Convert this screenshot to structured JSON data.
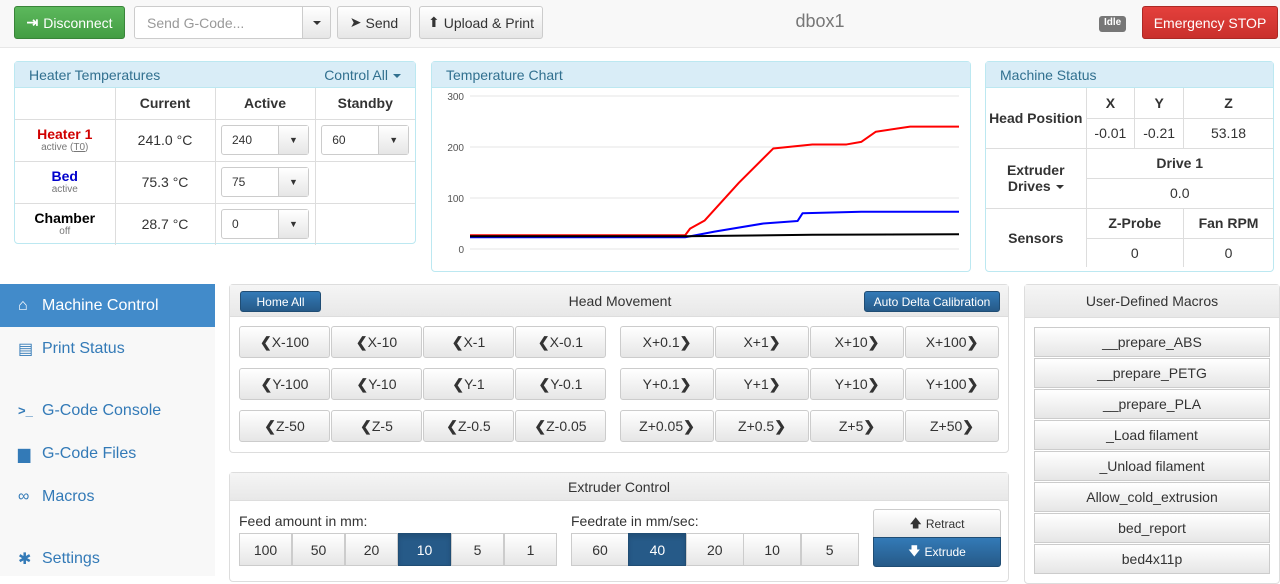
{
  "topbar": {
    "disconnect": "Disconnect",
    "gcode_placeholder": "Send G-Code...",
    "send": "Send",
    "upload_print": "Upload & Print",
    "machine_name": "dbox1",
    "status": "Idle",
    "emergency": "Emergency STOP"
  },
  "heaters": {
    "title": "Heater Temperatures",
    "control_all": "Control All",
    "headers": [
      "Current",
      "Active",
      "Standby"
    ],
    "rows": [
      {
        "name": "Heater 1",
        "state": "active",
        "tool": "T0",
        "current": "241.0 °C",
        "active": "240",
        "standby": "60",
        "color": "#d00000"
      },
      {
        "name": "Bed",
        "state": "active",
        "current": "75.3 °C",
        "active": "75",
        "color": "#0000cc"
      },
      {
        "name": "Chamber",
        "state": "off",
        "current": "28.7 °C",
        "active": "0",
        "color": "#000000"
      }
    ]
  },
  "chart": {
    "title": "Temperature Chart",
    "ylim": [
      0,
      300
    ],
    "yticks": [
      "300",
      "200",
      "100",
      "0"
    ]
  },
  "chart_data": {
    "type": "line",
    "ylim": [
      0,
      300
    ],
    "yticks": [
      0,
      100,
      200,
      300
    ],
    "grid": true,
    "series": [
      {
        "color": "#ff0000",
        "x": [
          0,
          30,
          40,
          44,
          45,
          48,
          55,
          62,
          70,
          77,
          80,
          83,
          90,
          100
        ],
        "values": [
          27,
          27,
          27,
          27,
          40,
          56,
          130,
          197,
          205,
          205,
          210,
          230,
          240,
          240
        ]
      },
      {
        "color": "#0000ff",
        "x": [
          0,
          30,
          44,
          50,
          60,
          67,
          68,
          80,
          100
        ],
        "values": [
          23,
          23,
          23,
          34,
          50,
          55,
          70,
          73,
          73
        ]
      },
      {
        "color": "#000000",
        "x": [
          0,
          30,
          44,
          70,
          100
        ],
        "values": [
          25,
          25,
          25,
          28,
          29
        ]
      }
    ]
  },
  "machine": {
    "title": "Machine Status",
    "head_position": "Head Position",
    "axes": [
      "X",
      "Y",
      "Z"
    ],
    "positions": [
      "-0.01",
      "-0.21",
      "53.18"
    ],
    "extruder_drives": "Extruder Drives",
    "drive_label": "Drive 1",
    "drive_value": "0.0",
    "sensors": "Sensors",
    "zprobe_label": "Z-Probe",
    "zprobe_value": "0",
    "fan_label": "Fan RPM",
    "fan_value": "0"
  },
  "sidebar": {
    "items": [
      {
        "label": "Machine Control",
        "icon": "home-icon",
        "glyph": "⌂"
      },
      {
        "label": "Print Status",
        "icon": "print-icon",
        "glyph": "▤"
      },
      {
        "label": "G-Code Console",
        "icon": "console-icon",
        "glyph": ">_"
      },
      {
        "label": "G-Code Files",
        "icon": "files-icon",
        "glyph": "▆"
      },
      {
        "label": "Macros",
        "icon": "link-icon",
        "glyph": "∞"
      },
      {
        "label": "Settings",
        "icon": "gear-icon",
        "glyph": "✱"
      }
    ]
  },
  "movement": {
    "home_all": "Home All",
    "title": "Head Movement",
    "auto_delta": "Auto Delta Calibration",
    "rows": [
      [
        "X-100",
        "X-10",
        "X-1",
        "X-0.1",
        "X+0.1",
        "X+1",
        "X+10",
        "X+100"
      ],
      [
        "Y-100",
        "Y-10",
        "Y-1",
        "Y-0.1",
        "Y+0.1",
        "Y+1",
        "Y+10",
        "Y+100"
      ],
      [
        "Z-50",
        "Z-5",
        "Z-0.5",
        "Z-0.05",
        "Z+0.05",
        "Z+0.5",
        "Z+5",
        "Z+50"
      ]
    ]
  },
  "extruder": {
    "title": "Extruder Control",
    "feed_label": "Feed amount in mm:",
    "feed_values": [
      "100",
      "50",
      "20",
      "10",
      "5",
      "1"
    ],
    "feed_selected": "10",
    "rate_label": "Feedrate in mm/sec:",
    "rate_values": [
      "60",
      "40",
      "20",
      "10",
      "5"
    ],
    "rate_selected": "40",
    "retract": "Retract",
    "extrude": "Extrude"
  },
  "macros": {
    "title": "User-Defined Macros",
    "items": [
      "__prepare_ABS",
      "__prepare_PETG",
      "__prepare_PLA",
      "_Load filament",
      "_Unload filament",
      "Allow_cold_extrusion",
      "bed_report",
      "bed4x11p"
    ]
  }
}
